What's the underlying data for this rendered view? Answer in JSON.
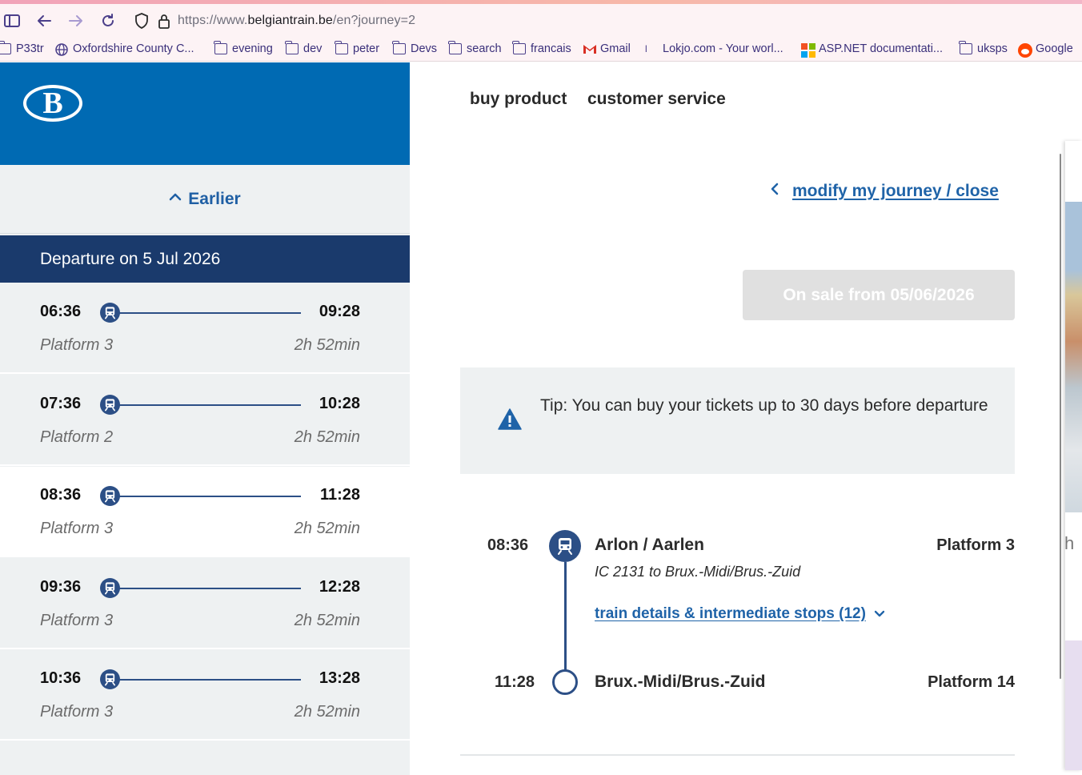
{
  "browser": {
    "url_prefix": "https://www.",
    "url_domain": "belgiantrain.be",
    "url_path": "/en?journey=2",
    "bookmarks": [
      {
        "label": "P33tr",
        "icon": "folder-icon"
      },
      {
        "label": "Oxfordshire County C...",
        "icon": "globe-icon"
      },
      {
        "label": "evening",
        "icon": "folder-icon"
      },
      {
        "label": "dev",
        "icon": "folder-icon"
      },
      {
        "label": "peter",
        "icon": "folder-icon"
      },
      {
        "label": "Devs",
        "icon": "folder-icon"
      },
      {
        "label": "search",
        "icon": "folder-icon"
      },
      {
        "label": "francais",
        "icon": "folder-icon"
      },
      {
        "label": "Gmail",
        "icon": "gmail-icon"
      },
      {
        "label": "Lokjo.com - Your worl...",
        "icon": "lokjo-icon"
      },
      {
        "label": "ASP.NET documentati...",
        "icon": "microsoft-icon"
      },
      {
        "label": "uksps",
        "icon": "folder-icon"
      },
      {
        "label": "Google",
        "icon": "reddit-icon"
      }
    ]
  },
  "site": {
    "logo_letter": "B",
    "nav": {
      "buy": "buy product",
      "service": "customer service"
    }
  },
  "results": {
    "earlier_label": "Earlier",
    "departure_header": "Departure on 5 Jul 2026",
    "journeys": [
      {
        "dep": "06:36",
        "arr": "09:28",
        "platform": "Platform 3",
        "duration": "2h 52min",
        "selected": false
      },
      {
        "dep": "07:36",
        "arr": "10:28",
        "platform": "Platform 2",
        "duration": "2h 52min",
        "selected": false
      },
      {
        "dep": "08:36",
        "arr": "11:28",
        "platform": "Platform 3",
        "duration": "2h 52min",
        "selected": true
      },
      {
        "dep": "09:36",
        "arr": "12:28",
        "platform": "Platform 3",
        "duration": "2h 52min",
        "selected": false
      },
      {
        "dep": "10:36",
        "arr": "13:28",
        "platform": "Platform 3",
        "duration": "2h 52min",
        "selected": false
      }
    ]
  },
  "detail": {
    "modify_label": "modify my journey / close",
    "sale_label": "On sale from 05/06/2026",
    "tip": "Tip: You can buy your tickets up to 30 days before departure",
    "segment": {
      "dep_time": "08:36",
      "dep_station": "Arlon / Aarlen",
      "dep_platform": "Platform 3",
      "train": "IC 2131 to Brux.-Midi/Brus.-Zuid",
      "details_link": "train details & intermediate stops (12)",
      "arr_time": "11:28",
      "arr_station": "Brux.-Midi/Brus.-Zuid",
      "arr_platform": "Platform 14"
    },
    "peek_letter": "h"
  },
  "colors": {
    "brand": "#006ab3",
    "header": "#1a3a6c",
    "link": "#1f63a8",
    "train": "#2c4f86"
  }
}
